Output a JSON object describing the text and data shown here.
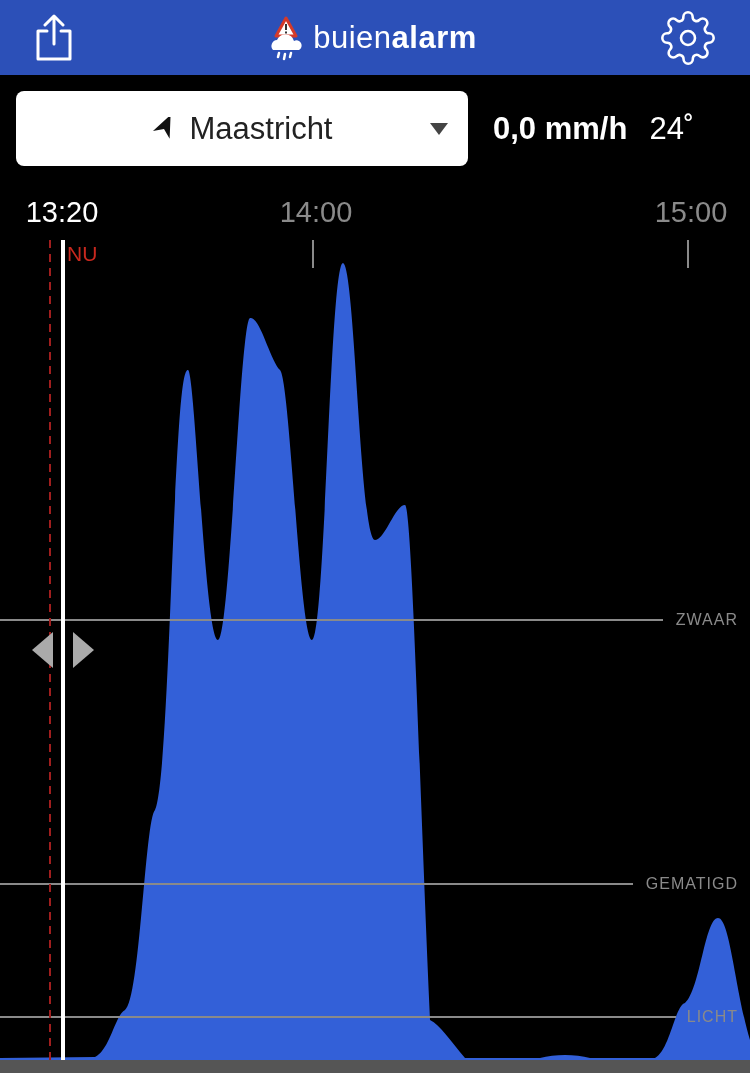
{
  "header": {
    "logo": "buien**alarm**"
  },
  "location": {
    "name": "Maastricht"
  },
  "current": {
    "rain": "0,0 mm/h",
    "temperature": "24˚"
  },
  "timeline": [
    {
      "label": "13:20",
      "kind": "now"
    },
    {
      "label": "14:00",
      "kind": "tick"
    },
    {
      "label": "15:00",
      "kind": "tick"
    }
  ],
  "now_marker": "NU",
  "levels": [
    {
      "label": "ZWAAR"
    },
    {
      "label": "GEMATIGD"
    },
    {
      "label": "LICHT"
    }
  ]
}
